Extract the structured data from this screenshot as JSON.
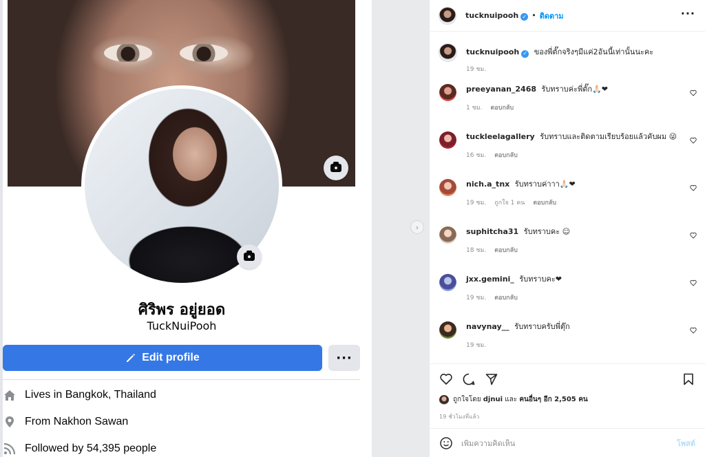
{
  "facebook": {
    "name": "ศิริพร อยู่ยอด",
    "username": "TuckNuiPooh",
    "edit_profile_label": "Edit profile",
    "more_label": "···",
    "info": {
      "lives_prefix": "Lives in ",
      "lives_value": "Bangkok, Thailand",
      "from_prefix": "From ",
      "from_value": "Nakhon Sawan",
      "followed_text": "Followed by 54,395 people"
    }
  },
  "instagram": {
    "header": {
      "username": "tucknuipooh",
      "dot": "•",
      "follow_label": "ติดตาม",
      "more_label": "···"
    },
    "caption": {
      "username": "tucknuipooh",
      "text": "ของพี่ตั๊กจริงๆมีแค่2อันนี้เท่านั้นนะคะ",
      "time": "19 ชม."
    },
    "comments": [
      {
        "username": "preeyanan_2468",
        "text": "รับทราบค่ะพี่ตั๊ก🙏🏻❤",
        "time": "1 ชม.",
        "likes": "",
        "reply": "ตอบกลับ"
      },
      {
        "username": "tuckleelagallery",
        "text": "รับทราบและติดตามเรียบร้อยแล้วคับผม 😜",
        "time": "16 ชม.",
        "likes": "",
        "reply": "ตอบกลับ"
      },
      {
        "username": "nich.a_tnx",
        "text": "รับทราบค่าาา🙏🏻❤",
        "time": "19 ชม.",
        "likes": "ถูกใจ 1 คน",
        "reply": "ตอบกลับ"
      },
      {
        "username": "suphitcha31",
        "text": "รับทราบคะ ☺",
        "time": "18 ชม.",
        "likes": "",
        "reply": "ตอบกลับ"
      },
      {
        "username": "jxx.gemini_",
        "text": "รับทราบคะ❤",
        "time": "19 ชม.",
        "likes": "",
        "reply": "ตอบกลับ"
      },
      {
        "username": "navynay__",
        "text": "รับทราบครับพี่ตุ๊ก",
        "time": "19 ชม.",
        "likes": "",
        "reply": "ตอบกลับ"
      }
    ],
    "likes": {
      "prefix": "ถูกใจโดย",
      "user": "djnui",
      "middle": "และ",
      "others": "คนอื่นๆ อีก 2,505 คน"
    },
    "post_time": "19 ชั่วโมงที่แล้ว",
    "comment_placeholder": "เพิ่มความคิดเห็น",
    "post_label": "โพสต์"
  },
  "colors": {
    "fb_blue": "#3578e5",
    "ig_blue": "#0095f6",
    "ig_post_disabled": "#b2dffc"
  },
  "icons": [
    "camera-icon",
    "pencil-icon",
    "home-icon",
    "location-pin-icon",
    "rss-icon",
    "verified-badge-icon",
    "heart-icon",
    "comment-icon",
    "share-icon",
    "bookmark-icon",
    "emoji-icon",
    "chevron-right-icon"
  ]
}
